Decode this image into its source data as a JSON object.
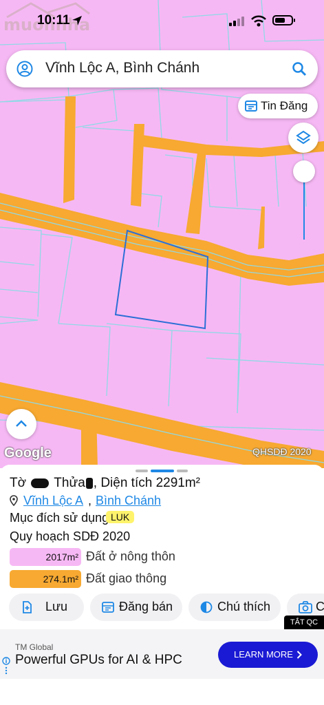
{
  "status_bar": {
    "time": "10:11"
  },
  "search": {
    "query": "Vĩnh Lộc A, Bình Chánh"
  },
  "map": {
    "tin_dang_label": "Tin Đăng",
    "google_label": "Google",
    "layer_label": "QHSDĐ 2020",
    "land_color": "#f6b8f4",
    "road_color": "#f7a931",
    "selected_outline_color": "#2b6fd6"
  },
  "parcel": {
    "title_prefix": "Tờ",
    "title_mid": "Thửa",
    "title_suffix": ", Diện tích 2291m²",
    "ward": "Vĩnh Lộc A",
    "district": "Bình Chánh",
    "purpose_label": "Mục đích sử dụng",
    "purpose_code": "LUK",
    "plan_label": "Quy hoạch SDĐ 2020",
    "legend": [
      {
        "area": "2017m²",
        "label": "Đất ở nông thôn",
        "color": "#f6b8f4"
      },
      {
        "area": "274.1m²",
        "label": "Đất giao thông",
        "color": "#f7a931"
      }
    ]
  },
  "actions": [
    {
      "label": "Lưu",
      "icon": "bookmark-add-icon"
    },
    {
      "label": "Đăng bán",
      "icon": "calendar-icon"
    },
    {
      "label": "Chú thích",
      "icon": "half-circle-icon"
    },
    {
      "label": "C",
      "icon": "camera-icon"
    }
  ],
  "ad": {
    "close_label": "TẮT QC",
    "brand": "TM Global",
    "headline": "Powerful GPUs for AI & HPC",
    "cta": "LEARN MORE"
  }
}
